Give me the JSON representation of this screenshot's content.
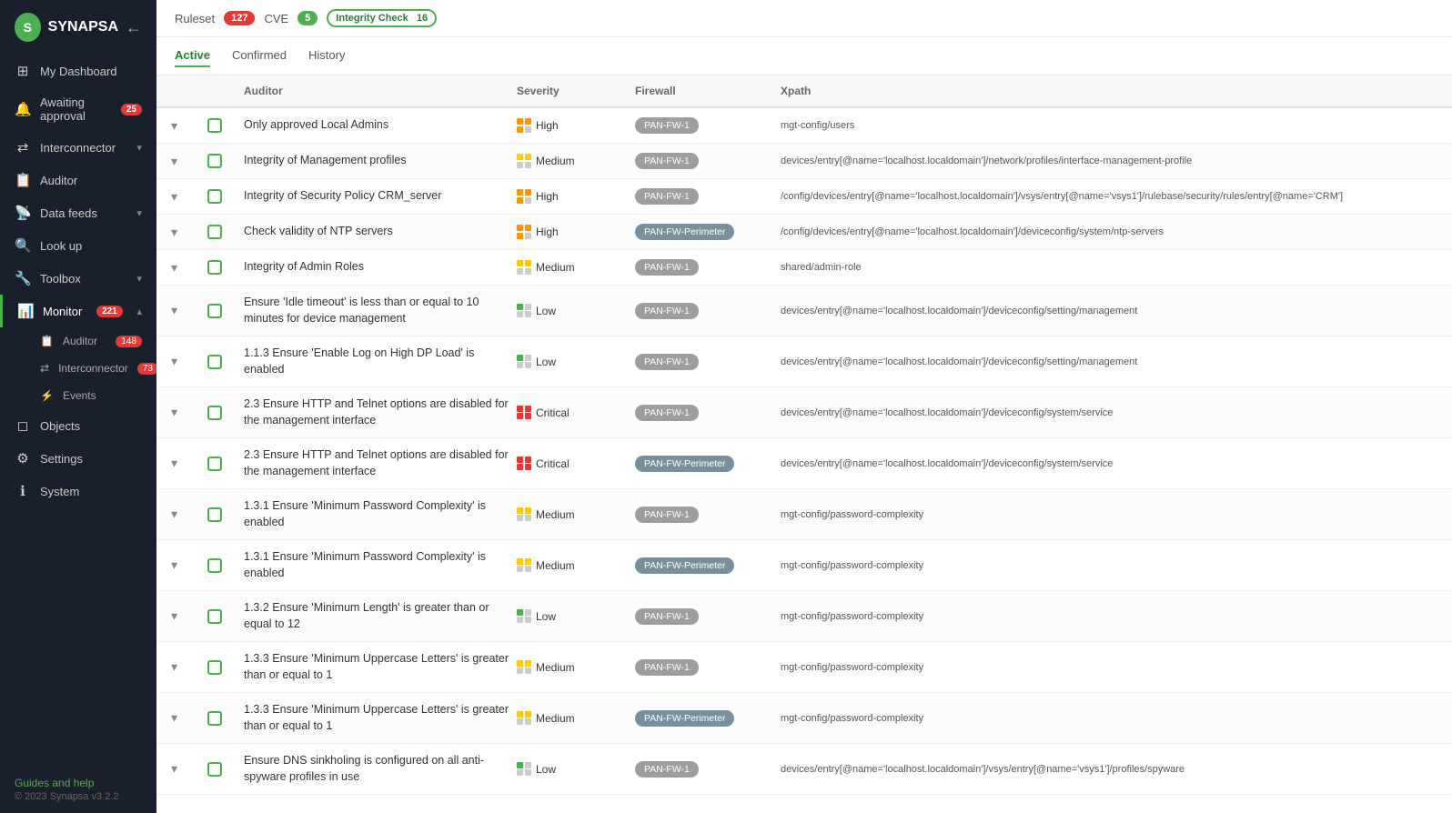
{
  "app": {
    "logo_text": "SYNAPSA"
  },
  "sidebar": {
    "collapse_icon": "←",
    "items": [
      {
        "id": "dashboard",
        "label": "My Dashboard",
        "icon": "⊞",
        "badge": null,
        "active": false
      },
      {
        "id": "awaiting",
        "label": "Awaiting approval",
        "icon": "🔔",
        "badge": "25",
        "active": false
      },
      {
        "id": "interconnector",
        "label": "Interconnector",
        "icon": "⇄",
        "badge": null,
        "chevron": "▾",
        "active": false
      },
      {
        "id": "auditor",
        "label": "Auditor",
        "icon": "📋",
        "badge": null,
        "active": false
      },
      {
        "id": "datafeeds",
        "label": "Data feeds",
        "icon": "📡",
        "badge": null,
        "chevron": "▾",
        "active": false
      },
      {
        "id": "lookup",
        "label": "Look up",
        "icon": "🔍",
        "badge": null,
        "active": false
      },
      {
        "id": "toolbox",
        "label": "Toolbox",
        "icon": "🔧",
        "badge": null,
        "chevron": "▾",
        "active": false
      },
      {
        "id": "monitor",
        "label": "Monitor",
        "icon": "📊",
        "badge": "221",
        "chevron": "▴",
        "active": true
      },
      {
        "id": "objects",
        "label": "Objects",
        "icon": "◻",
        "badge": null,
        "active": false
      },
      {
        "id": "settings",
        "label": "Settings",
        "icon": "⚙",
        "badge": null,
        "active": false
      },
      {
        "id": "system",
        "label": "System",
        "icon": "ℹ",
        "badge": null,
        "active": false
      }
    ],
    "sub_items": [
      {
        "id": "auditor-sub",
        "label": "Auditor",
        "badge": "148",
        "icon": "📋"
      },
      {
        "id": "interconnector-sub",
        "label": "Interconnector",
        "badge": "73",
        "icon": "⇄"
      },
      {
        "id": "events",
        "label": "Events",
        "icon": "⚡",
        "badge": null
      }
    ],
    "footer": {
      "guides_label": "Guides and help",
      "version": "© 2023 Synapsa v3.2.2"
    }
  },
  "ruleset_bar": {
    "ruleset_label": "Ruleset",
    "ruleset_count": "127",
    "cve_label": "CVE",
    "cve_count": "5",
    "integrity_label": "Integrity Check",
    "integrity_count": "16"
  },
  "tabs": {
    "items": [
      "Active",
      "Confirmed",
      "History"
    ],
    "active": "Active"
  },
  "table": {
    "headers": [
      "",
      "",
      "Auditor",
      "Severity",
      "Firewall",
      "Xpath"
    ],
    "rows": [
      {
        "auditor": "Only approved Local Admins",
        "severity_label": "High",
        "severity_class": "sev-high",
        "firewall": "PAN-FW-1",
        "firewall_class": "",
        "xpath": "mgt-config/users"
      },
      {
        "auditor": "Integrity of Management profiles",
        "severity_label": "Medium",
        "severity_class": "sev-medium",
        "firewall": "PAN-FW-1",
        "firewall_class": "",
        "xpath": "devices/entry[@name='localhost.localdomain']/network/profiles/interface-management-profile"
      },
      {
        "auditor": "Integrity of Security Policy CRM_server",
        "severity_label": "High",
        "severity_class": "sev-high",
        "firewall": "PAN-FW-1",
        "firewall_class": "",
        "xpath": "/config/devices/entry[@name='localhost.localdomain']/vsys/entry[@name='vsys1']/rulebase/security/rules/entry[@name='CRM']"
      },
      {
        "auditor": "Check validity of NTP servers",
        "severity_label": "High",
        "severity_class": "sev-high",
        "firewall": "PAN-FW-Perimeter",
        "firewall_class": "perimeter",
        "xpath": "/config/devices/entry[@name='localhost.localdomain']/deviceconfig/system/ntp-servers"
      },
      {
        "auditor": "Integrity of Admin Roles",
        "severity_label": "Medium",
        "severity_class": "sev-medium",
        "firewall": "PAN-FW-1",
        "firewall_class": "",
        "xpath": "shared/admin-role"
      },
      {
        "auditor": "Ensure 'Idle timeout' is less than or equal to 10 minutes for device management",
        "severity_label": "Low",
        "severity_class": "sev-low",
        "firewall": "PAN-FW-1",
        "firewall_class": "",
        "xpath": "devices/entry[@name='localhost.localdomain']/deviceconfig/setting/management"
      },
      {
        "auditor": "1.1.3 Ensure 'Enable Log on High DP Load' is enabled",
        "severity_label": "Low",
        "severity_class": "sev-low",
        "firewall": "PAN-FW-1",
        "firewall_class": "",
        "xpath": "devices/entry[@name='localhost.localdomain']/deviceconfig/setting/management"
      },
      {
        "auditor": "2.3 Ensure HTTP and Telnet options are disabled for the management interface",
        "severity_label": "Critical",
        "severity_class": "sev-critical",
        "firewall": "PAN-FW-1",
        "firewall_class": "",
        "xpath": "devices/entry[@name='localhost.localdomain']/deviceconfig/system/service"
      },
      {
        "auditor": "2.3 Ensure HTTP and Telnet options are disabled for the management interface",
        "severity_label": "Critical",
        "severity_class": "sev-critical",
        "firewall": "PAN-FW-Perimeter",
        "firewall_class": "perimeter",
        "xpath": "devices/entry[@name='localhost.localdomain']/deviceconfig/system/service"
      },
      {
        "auditor": "1.3.1 Ensure 'Minimum Password Complexity' is enabled",
        "severity_label": "Medium",
        "severity_class": "sev-medium",
        "firewall": "PAN-FW-1",
        "firewall_class": "",
        "xpath": "mgt-config/password-complexity"
      },
      {
        "auditor": "1.3.1 Ensure 'Minimum Password Complexity' is enabled",
        "severity_label": "Medium",
        "severity_class": "sev-medium",
        "firewall": "PAN-FW-Perimeter",
        "firewall_class": "perimeter",
        "xpath": "mgt-config/password-complexity"
      },
      {
        "auditor": "1.3.2 Ensure 'Minimum Length' is greater than or equal to 12",
        "severity_label": "Low",
        "severity_class": "sev-low",
        "firewall": "PAN-FW-1",
        "firewall_class": "",
        "xpath": "mgt-config/password-complexity"
      },
      {
        "auditor": "1.3.3 Ensure 'Minimum Uppercase Letters' is greater than or equal to 1",
        "severity_label": "Medium",
        "severity_class": "sev-medium",
        "firewall": "PAN-FW-1",
        "firewall_class": "",
        "xpath": "mgt-config/password-complexity"
      },
      {
        "auditor": "1.3.3 Ensure 'Minimum Uppercase Letters' is greater than or equal to 1",
        "severity_label": "Medium",
        "severity_class": "sev-medium",
        "firewall": "PAN-FW-Perimeter",
        "firewall_class": "perimeter",
        "xpath": "mgt-config/password-complexity"
      },
      {
        "auditor": "Ensure DNS sinkholing is configured on all anti-spyware profiles in use",
        "severity_label": "Low",
        "severity_class": "sev-low",
        "firewall": "PAN-FW-1",
        "firewall_class": "",
        "xpath": "devices/entry[@name='localhost.localdomain']/vsys/entry[@name='vsys1']/profiles/spyware"
      }
    ]
  }
}
